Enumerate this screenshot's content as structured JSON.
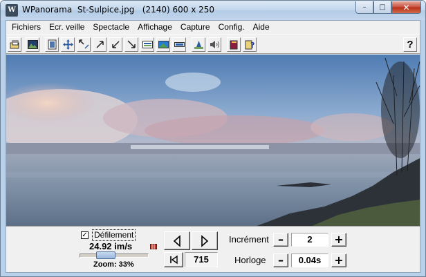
{
  "window": {
    "title": "WPanorama  St-Sulpice.jpg   (2140) 600 x 250",
    "app_icon_glyph": "W",
    "caption_buttons": {
      "minimize": "–",
      "maximize": "□",
      "close": "✕"
    }
  },
  "menu": {
    "items": [
      "Fichiers",
      "Ecr. veille",
      "Spectacle",
      "Affichage",
      "Capture",
      "Config.",
      "Aide"
    ]
  },
  "toolbar": {
    "buttons": [
      "open-file-icon",
      "image-icon",
      "fit-window-icon",
      "move-icon",
      "shrink-icon",
      "expand-up-icon",
      "expand-down-icon",
      "corner-icon",
      "panorama-a-icon",
      "panorama-b-icon",
      "panorama-c-icon",
      "level-icon",
      "sound-icon",
      "book-icon",
      "help-page-icon"
    ],
    "help_label": "?"
  },
  "controls": {
    "scroll_checkbox_label": "Défilement",
    "scroll_checked": true,
    "scroll_check_glyph": "✓",
    "speed_text": "24.92 im/s",
    "zoom_text": "Zoom: 33%",
    "zoom_fraction": 0.33,
    "prev_glyph": "◁",
    "next_glyph": "▷",
    "first_glyph": "|◁",
    "frame_value": "715",
    "increment_label": "Incrément",
    "increment_value": "2",
    "clock_label": "Horloge",
    "clock_value": "0.04s",
    "minus_glyph": "–",
    "plus_glyph": "+"
  },
  "colors": {
    "sky_top": "#5a83b7",
    "sky_mid": "#a9bfd9",
    "cloud_pink": "#d8b3b4",
    "water": "#7b8ea4",
    "title_bar": "#c2d6ec",
    "close_button": "#c74d3a"
  }
}
